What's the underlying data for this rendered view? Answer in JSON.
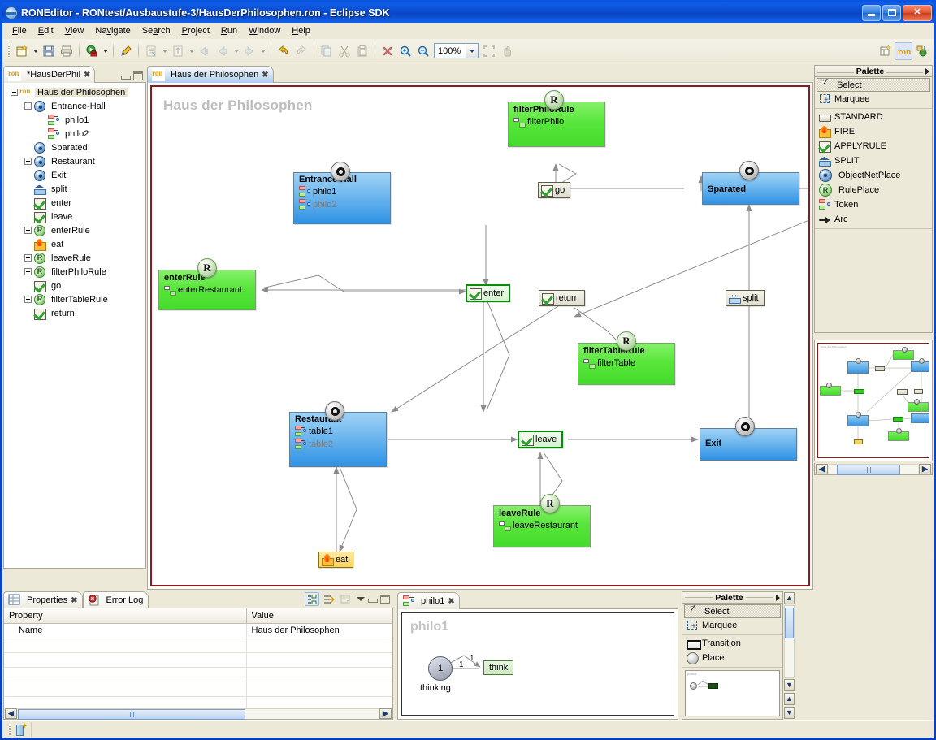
{
  "window": {
    "title": "RONEditor - RONtest/Ausbaustufe-3/HausDerPhilosophen.ron - Eclipse SDK",
    "minimize_label": "Minimize",
    "maximize_label": "Maximize",
    "close_label": "Close"
  },
  "menubar": {
    "items": [
      {
        "label": "File",
        "mnemonic": "F"
      },
      {
        "label": "Edit",
        "mnemonic": "E"
      },
      {
        "label": "View",
        "mnemonic": "V"
      },
      {
        "label": "Navigate",
        "mnemonic": "N"
      },
      {
        "label": "Search",
        "mnemonic": "S"
      },
      {
        "label": "Project",
        "mnemonic": "P"
      },
      {
        "label": "Run",
        "mnemonic": "R"
      },
      {
        "label": "Window",
        "mnemonic": "W"
      },
      {
        "label": "Help",
        "mnemonic": "H"
      }
    ]
  },
  "toolbar": {
    "zoom_value": "100%",
    "icons": [
      "new-wizard-icon",
      "save-icon",
      "print-icon",
      "run-icon",
      "debug-icon",
      "open-type-icon",
      "open-resource-icon",
      "back-icon",
      "forward-icon",
      "undo-icon",
      "redo-icon",
      "copy-icon",
      "cut-icon",
      "paste-icon",
      "delete-icon",
      "zoom-in-icon",
      "zoom-out-icon",
      "fit-page-icon",
      "pan-icon",
      "new-perspective-icon",
      "ron-perspective-icon",
      "java-perspective-icon"
    ]
  },
  "tree_view": {
    "tab_label": "*HausDerPhil",
    "tab_icon": "ron-file-icon",
    "root": "Haus der Philosophen",
    "items": [
      {
        "label": "Haus der Philosophen",
        "icon": "ron-file-icon",
        "indent": 0,
        "expander": "minus",
        "selected": true
      },
      {
        "label": "Entrance-Hall",
        "icon": "objectnetplace-icon",
        "indent": 1,
        "expander": "minus",
        "selected": false
      },
      {
        "label": "philo1",
        "icon": "token-icon",
        "indent": 2,
        "expander": "none",
        "selected": false
      },
      {
        "label": "philo2",
        "icon": "token-icon",
        "indent": 2,
        "expander": "none",
        "selected": false
      },
      {
        "label": "Sparated",
        "icon": "objectnetplace-icon",
        "indent": 1,
        "expander": "none",
        "selected": false
      },
      {
        "label": "Restaurant",
        "icon": "objectnetplace-icon",
        "indent": 1,
        "expander": "plus",
        "selected": false
      },
      {
        "label": "Exit",
        "icon": "objectnetplace-icon",
        "indent": 1,
        "expander": "none",
        "selected": false
      },
      {
        "label": "split",
        "icon": "split-icon",
        "indent": 1,
        "expander": "none",
        "selected": false
      },
      {
        "label": "enter",
        "icon": "applyrule-icon",
        "indent": 1,
        "expander": "none",
        "selected": false
      },
      {
        "label": "leave",
        "icon": "applyrule-icon",
        "indent": 1,
        "expander": "none",
        "selected": false
      },
      {
        "label": "enterRule",
        "icon": "ruleplace-icon",
        "indent": 1,
        "expander": "plus",
        "selected": false
      },
      {
        "label": "eat",
        "icon": "fire-icon",
        "indent": 1,
        "expander": "none",
        "selected": false
      },
      {
        "label": "leaveRule",
        "icon": "ruleplace-icon",
        "indent": 1,
        "expander": "plus",
        "selected": false
      },
      {
        "label": "filterPhiloRule",
        "icon": "ruleplace-icon",
        "indent": 1,
        "expander": "plus",
        "selected": false
      },
      {
        "label": "go",
        "icon": "applyrule-icon",
        "indent": 1,
        "expander": "none",
        "selected": false
      },
      {
        "label": "filterTableRule",
        "icon": "ruleplace-icon",
        "indent": 1,
        "expander": "plus",
        "selected": false
      },
      {
        "label": "return",
        "icon": "applyrule-icon",
        "indent": 1,
        "expander": "none",
        "selected": false
      }
    ]
  },
  "editor": {
    "tab_label": "Haus der Philosophen",
    "tab_icon": "ron-file-icon",
    "diagram_title": "Haus der Philosophen",
    "nodes": {
      "entrance_hall": {
        "title": "Entrance-Hall",
        "tokens": [
          "philo1",
          "philo2"
        ],
        "badge": "O"
      },
      "sparated": {
        "title": "Sparated",
        "tokens": [],
        "badge": "O"
      },
      "restaurant": {
        "title": "Restaurant",
        "tokens": [
          "table1",
          "table2"
        ],
        "badge": "O"
      },
      "exit": {
        "title": "Exit",
        "tokens": [],
        "badge": "O"
      },
      "enter_rule": {
        "title": "enterRule",
        "sub": "enterRestaurant",
        "badge": "R"
      },
      "leave_rule": {
        "title": "leaveRule",
        "sub": "leaveRestaurant",
        "badge": "R"
      },
      "filter_philo_rule": {
        "title": "filterPhiloRule",
        "sub": "filterPhilo",
        "badge": "R"
      },
      "filter_table_rule": {
        "title": "filterTableRule",
        "sub": "filterTable",
        "badge": "R"
      },
      "enter": {
        "label": "enter"
      },
      "leave": {
        "label": "leave"
      },
      "go": {
        "label": "go"
      },
      "return": {
        "label": "return"
      },
      "split": {
        "label": "split"
      },
      "eat": {
        "label": "eat"
      }
    }
  },
  "palette_main": {
    "title": "Palette",
    "tools": [
      {
        "label": "Select",
        "icon": "select-arrow-icon",
        "selected": true
      },
      {
        "label": "Marquee",
        "icon": "marquee-icon",
        "selected": false
      }
    ],
    "elements": [
      {
        "label": "STANDARD",
        "icon": "standard-icon"
      },
      {
        "label": "FIRE",
        "icon": "fire-icon"
      },
      {
        "label": "APPLYRULE",
        "icon": "applyrule-icon"
      },
      {
        "label": "SPLIT",
        "icon": "split-icon"
      },
      {
        "label": "ObjectNetPlace",
        "icon": "objectnetplace-icon"
      },
      {
        "label": "RulePlace",
        "icon": "ruleplace-icon"
      },
      {
        "label": "Token",
        "icon": "token-icon"
      },
      {
        "label": "Arc",
        "icon": "arc-icon"
      }
    ]
  },
  "outline": {
    "thumbnail_title": "Haus der Philosophen"
  },
  "properties_view": {
    "tabs": [
      {
        "label": "Properties",
        "icon": "properties-icon",
        "selected": true
      },
      {
        "label": "Error Log",
        "icon": "error-log-icon",
        "selected": false
      }
    ],
    "columns": [
      "Property",
      "Value"
    ],
    "rows": [
      {
        "property": "Name",
        "value": "Haus der Philosophen"
      },
      {
        "property": "",
        "value": ""
      },
      {
        "property": "",
        "value": ""
      },
      {
        "property": "",
        "value": ""
      },
      {
        "property": "",
        "value": ""
      },
      {
        "property": "",
        "value": ""
      }
    ],
    "toolbar_icons": [
      "show-categories-icon",
      "show-advanced-icon",
      "restore-default-icon",
      "view-menu-icon"
    ]
  },
  "philo_editor": {
    "tab_label": "philo1",
    "tab_icon": "token-icon",
    "diagram_title": "philo1",
    "place": {
      "label": "1",
      "name": "thinking"
    },
    "transition": {
      "label": "think"
    },
    "arc_labels": [
      "1",
      "1"
    ]
  },
  "palette_philo": {
    "title": "Palette",
    "tools": [
      {
        "label": "Select",
        "icon": "select-arrow-icon",
        "selected": true
      },
      {
        "label": "Marquee",
        "icon": "marquee-icon",
        "selected": false
      }
    ],
    "elements": [
      {
        "label": "Transition",
        "icon": "transition-icon"
      },
      {
        "label": "Place",
        "icon": "place-icon"
      }
    ],
    "thumbnail_title": "philo1"
  },
  "statusbar": {
    "icon": "insert-mode-icon",
    "text": ""
  },
  "colors": {
    "title_blue": "#0A46C8",
    "chrome": "#ECE9D8",
    "place_blue": "#2E92E4",
    "rule_green": "#44DB2B",
    "canvas_border": "#8B1A1A",
    "ghost_title": "#BDBDBD"
  }
}
